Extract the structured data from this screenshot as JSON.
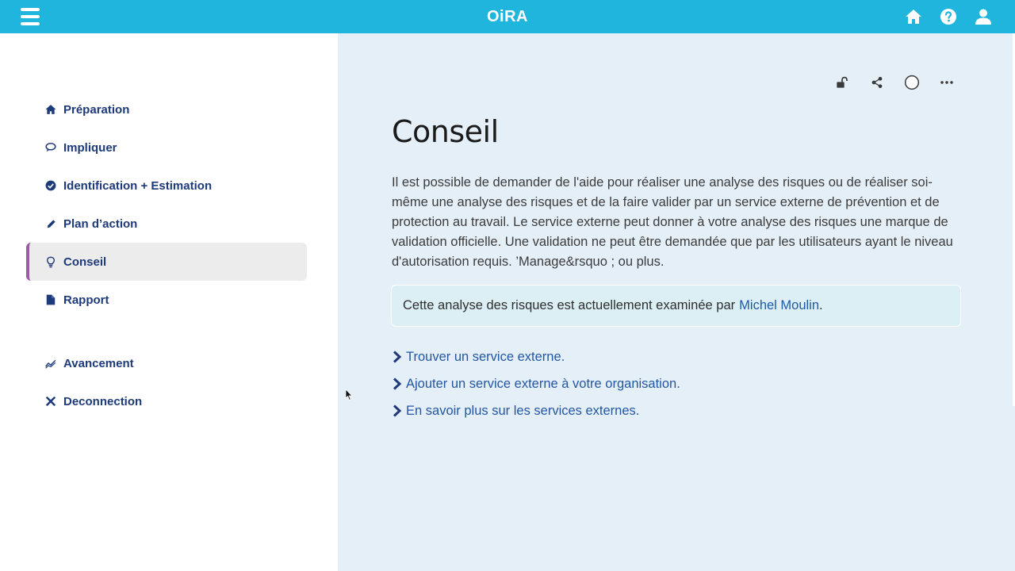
{
  "app": {
    "logo": "OiRA"
  },
  "topbar": {
    "icons": [
      "menu-icon",
      "home-icon",
      "help-icon",
      "user-icon"
    ]
  },
  "sidebar": {
    "items": [
      {
        "label": "Préparation",
        "icon": "home-icon"
      },
      {
        "label": "Impliquer",
        "icon": "chat-icon"
      },
      {
        "label": "Identification + Estimation",
        "icon": "check-circle-icon"
      },
      {
        "label": "Plan d’action",
        "icon": "pencil-icon"
      },
      {
        "label": "Conseil",
        "icon": "lightbulb-icon",
        "active": true
      },
      {
        "label": "Rapport",
        "icon": "document-icon"
      },
      {
        "label": "Avancement",
        "icon": "trend-icon"
      },
      {
        "label": "Deconnection",
        "icon": "close-icon"
      }
    ]
  },
  "main": {
    "toolbar": [
      "unlock-icon",
      "share-icon",
      "circle-icon",
      "more-icon"
    ],
    "title": "Conseil",
    "intro": "Il est possible de demander de l'aide pour réaliser une analyse des risques ou de réaliser soi-même une analyse des risques et de la faire valider par un service externe de prévention et de protection au travail. Le service externe peut donner à votre analyse des risques une marque de validation officielle. Une validation ne peut être demandée que par les utilisateurs ayant le niveau d'autorisation requis. ’Manage&rsquo ; ou plus.",
    "notice": {
      "text": "Cette analyse des risques est actuellement examinée par",
      "person": "Michel Moulin",
      "suffix": "."
    },
    "links": [
      "Trouver un service externe.",
      "Ajouter un service externe à votre organisation.",
      "En savoir plus sur les services externes."
    ]
  },
  "colors": {
    "topbar": "#1fb5dc",
    "nav_text": "#1d3a7a",
    "active_accent": "#9b5ba5",
    "main_bg": "#e4eff7",
    "link": "#2457a3"
  }
}
